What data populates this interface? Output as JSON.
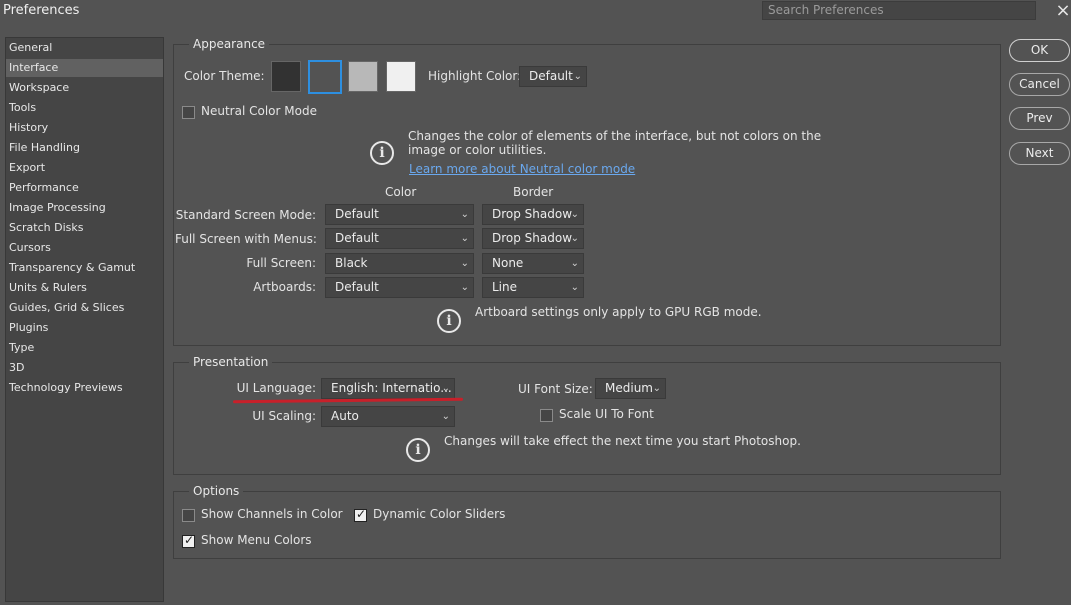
{
  "window": {
    "title": "Preferences",
    "search_placeholder": "Search Preferences",
    "close_icon": "×"
  },
  "sidebar": {
    "items": [
      {
        "label": "General"
      },
      {
        "label": "Interface",
        "active": true
      },
      {
        "label": "Workspace"
      },
      {
        "label": "Tools"
      },
      {
        "label": "History"
      },
      {
        "label": "File Handling"
      },
      {
        "label": "Export"
      },
      {
        "label": "Performance"
      },
      {
        "label": "Image Processing"
      },
      {
        "label": "Scratch Disks"
      },
      {
        "label": "Cursors"
      },
      {
        "label": "Transparency & Gamut"
      },
      {
        "label": "Units & Rulers"
      },
      {
        "label": "Guides, Grid & Slices"
      },
      {
        "label": "Plugins"
      },
      {
        "label": "Type"
      },
      {
        "label": "3D"
      },
      {
        "label": "Technology Previews"
      }
    ]
  },
  "appearance": {
    "group_label": "Appearance",
    "color_theme_label": "Color Theme:",
    "themes": [
      "#323232",
      "#535353",
      "#b8b8b8",
      "#f0f0f0"
    ],
    "selected_theme_color": "#2d8fe0",
    "highlight_color_label": "Highlight Color:",
    "highlight_color_value": "Default",
    "neutral_color_mode_label": "Neutral Color Mode",
    "neutral_info_line1": "Changes the color of elements of the interface, but not colors on the",
    "neutral_info_line2": "image or color utilities.",
    "neutral_link": "Learn more about Neutral color mode",
    "col_color": "Color",
    "col_border": "Border",
    "rows": [
      {
        "label": "Standard Screen Mode:",
        "color": "Default",
        "border": "Drop Shadow"
      },
      {
        "label": "Full Screen with Menus:",
        "color": "Default",
        "border": "Drop Shadow"
      },
      {
        "label": "Full Screen:",
        "color": "Black",
        "border": "None"
      },
      {
        "label": "Artboards:",
        "color": "Default",
        "border": "Line"
      }
    ],
    "artboard_note": "Artboard settings only apply to GPU RGB mode."
  },
  "presentation": {
    "group_label": "Presentation",
    "ui_language_label": "UI Language:",
    "ui_language_value": "English: Internatio...",
    "ui_font_size_label": "UI Font Size:",
    "ui_font_size_value": "Medium",
    "ui_scaling_label": "UI Scaling:",
    "ui_scaling_value": "Auto",
    "scale_ui_to_font_label": "Scale UI To Font",
    "note": "Changes will take effect the next time you start Photoshop."
  },
  "options": {
    "group_label": "Options",
    "show_channels_label": "Show Channels in Color",
    "dynamic_sliders_label": "Dynamic Color Sliders",
    "show_menu_colors_label": "Show Menu Colors",
    "show_channels_checked": false,
    "dynamic_sliders_checked": true,
    "show_menu_colors_checked": true
  },
  "buttons": {
    "ok": "OK",
    "cancel": "Cancel",
    "prev": "Prev",
    "next": "Next"
  },
  "icons": {
    "info": "i",
    "chevron": "⌄",
    "check": "✓"
  },
  "annotation_color": "#c8202a"
}
